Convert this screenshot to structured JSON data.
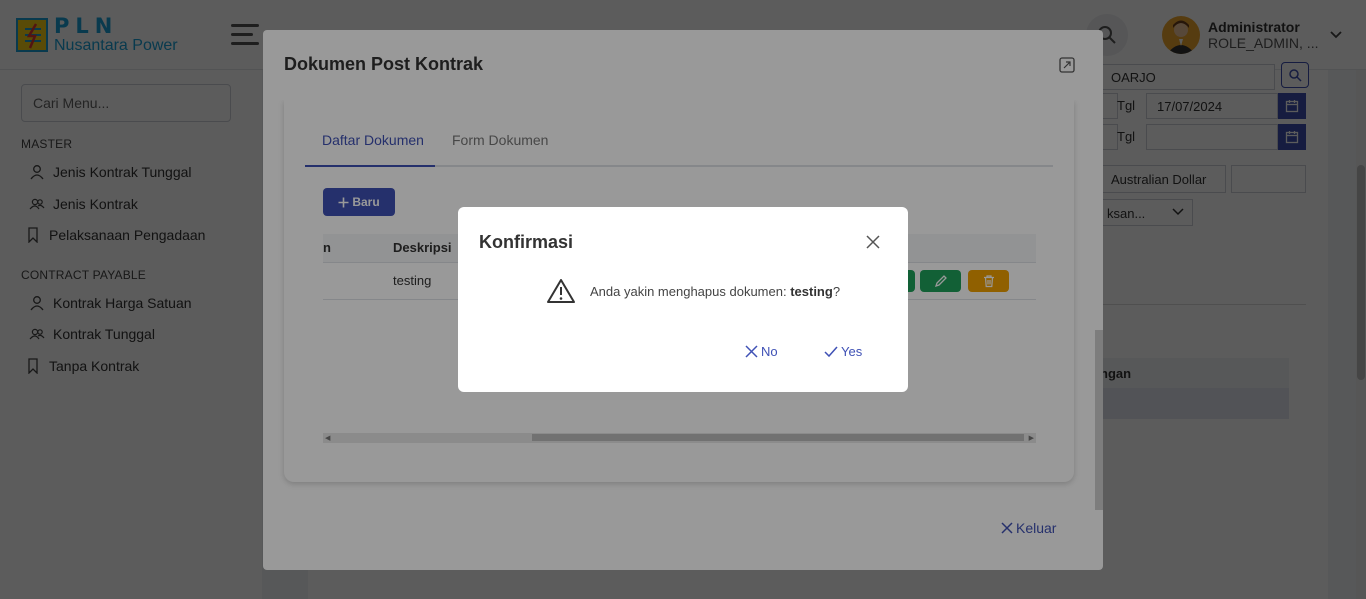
{
  "brand": {
    "top": "PLN",
    "bottom": "Nusantara Power"
  },
  "user": {
    "name": "Administrator",
    "role": "ROLE_ADMIN, ..."
  },
  "sidebar": {
    "search_placeholder": "Cari Menu...",
    "sections": [
      {
        "title": "MASTER",
        "items": [
          {
            "label": "Jenis Kontrak Tunggal",
            "icon": "user-icon"
          },
          {
            "label": "Jenis Kontrak",
            "icon": "users-icon"
          },
          {
            "label": "Pelaksanaan Pengadaan",
            "icon": "bookmark-icon"
          }
        ]
      },
      {
        "title": "CONTRACT PAYABLE",
        "items": [
          {
            "label": "Kontrak Harga Satuan",
            "icon": "user-icon"
          },
          {
            "label": "Kontrak Tunggal",
            "icon": "users-icon"
          },
          {
            "label": "Tanpa Kontrak",
            "icon": "bookmark-icon"
          }
        ]
      }
    ]
  },
  "background_form": {
    "location_value": "OARJO",
    "tgl_label_1": "Tgl",
    "tgl_value_1": "17/07/2024",
    "tgl_label_2": "Tgl",
    "tgl_value_2": "",
    "currency_value": "Australian Dollar",
    "select_value": "ksan...",
    "table_header_fragment": "ngan"
  },
  "doc_dialog": {
    "title": "Dokumen Post Kontrak",
    "tabs": [
      {
        "label": "Daftar Dokumen",
        "active": true
      },
      {
        "label": "Form Dokumen",
        "active": false
      }
    ],
    "new_button": "Baru",
    "table": {
      "columns": [
        "n",
        "Deskripsi"
      ],
      "rows": [
        {
          "deskripsi": "testing"
        }
      ]
    },
    "close_button": "Keluar"
  },
  "confirm_dialog": {
    "title": "Konfirmasi",
    "message_prefix": "Anda yakin menghapus dokumen:",
    "message_target": "testing",
    "message_suffix": "?",
    "no_label": "No",
    "yes_label": "Yes"
  },
  "colors": {
    "primary": "#3f51b5",
    "download_green": "#1fa05b",
    "edit_green": "#1fa05b",
    "delete_orange": "#f0a000"
  }
}
